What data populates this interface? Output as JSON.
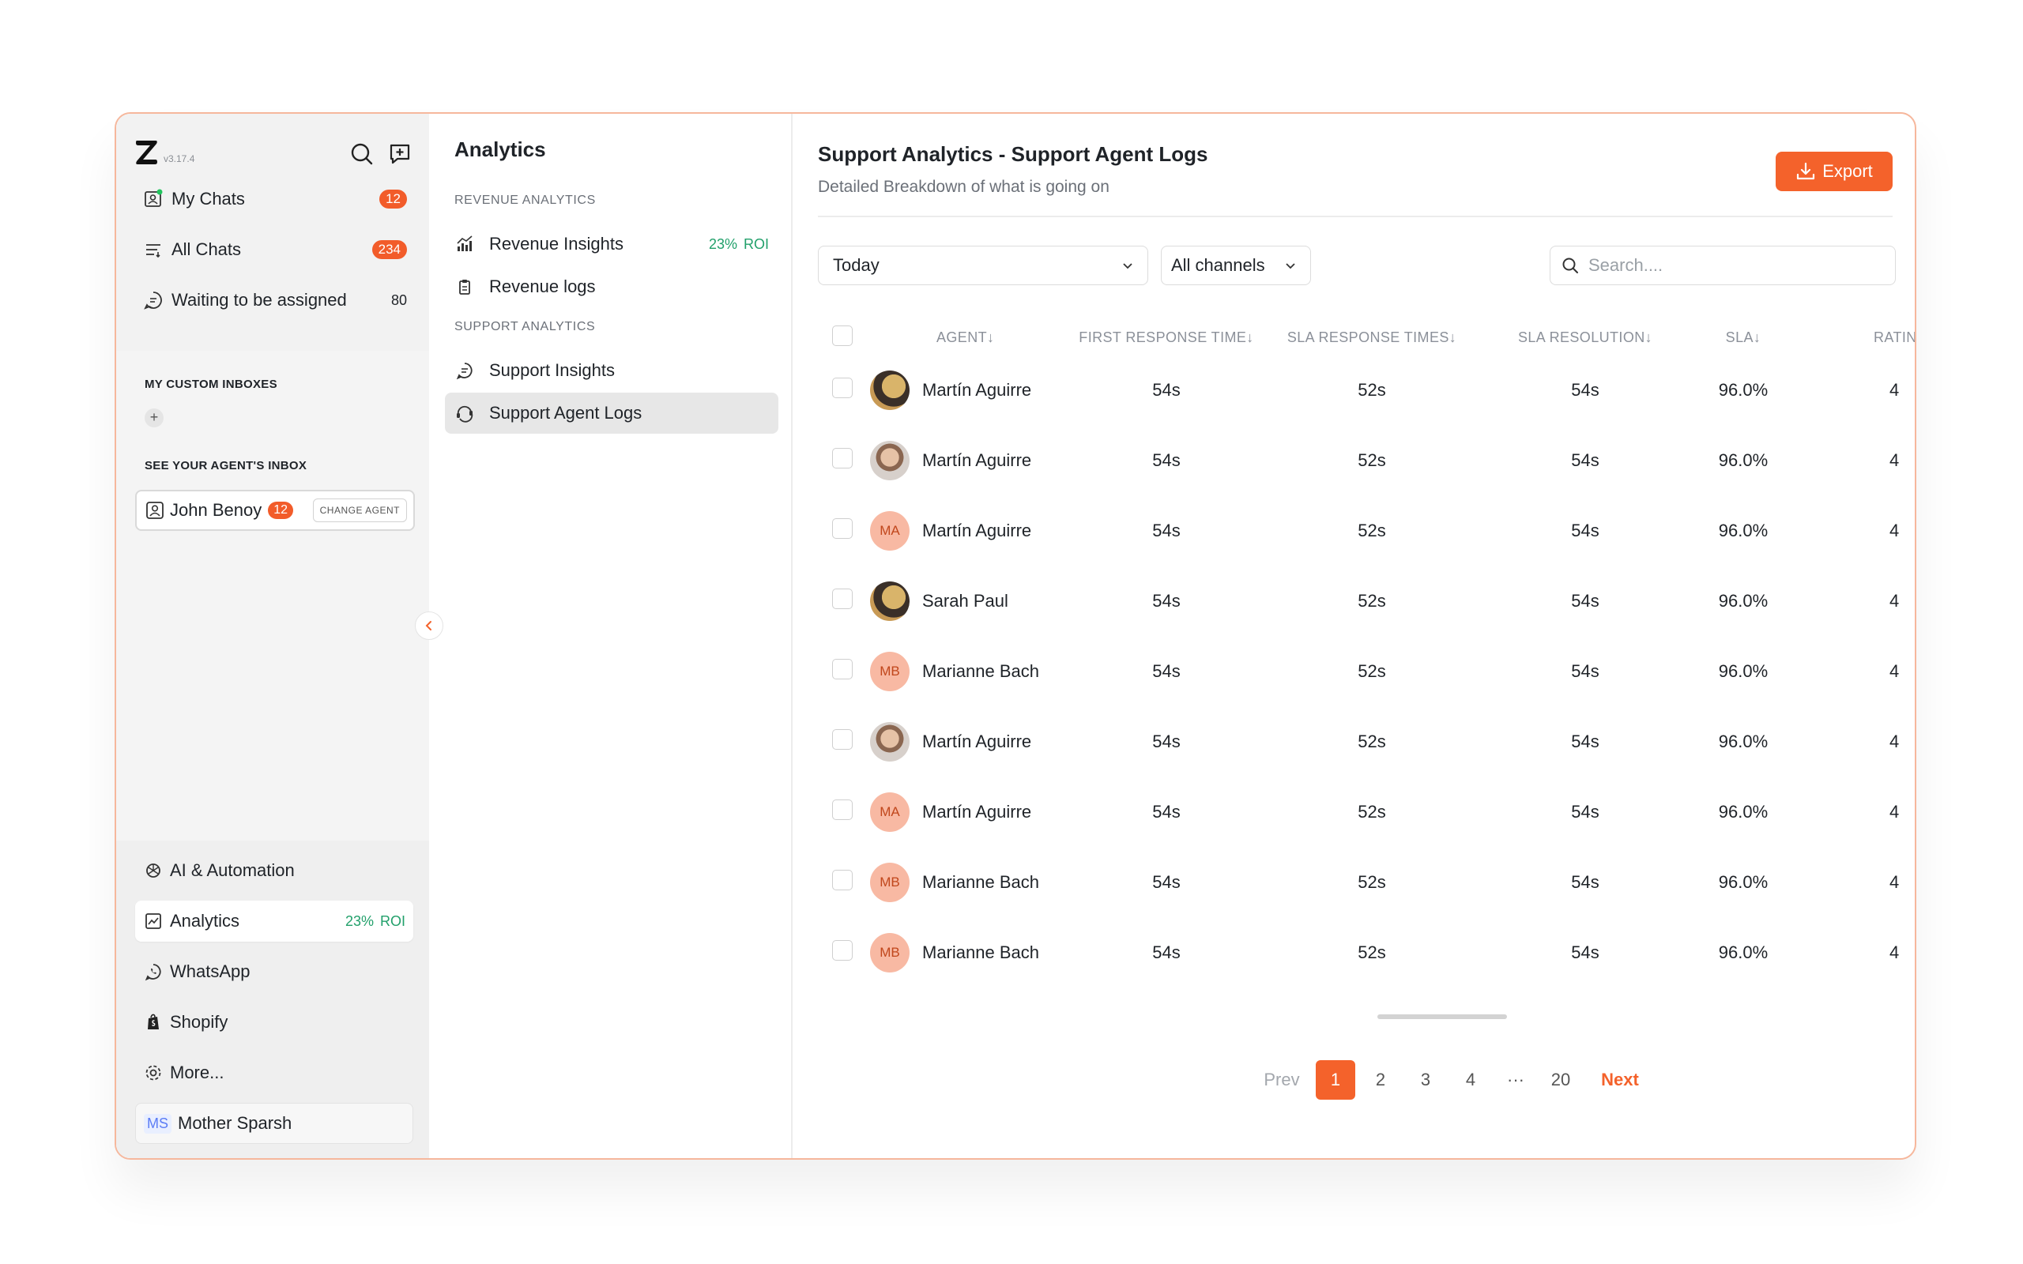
{
  "app": {
    "version": "v3.17.4",
    "accent": "#f4622b"
  },
  "sidebar": {
    "nav": [
      {
        "label": "My Chats",
        "count": "12",
        "icon": "chat-user-icon"
      },
      {
        "label": "All Chats",
        "count": "234",
        "icon": "list-filter-icon"
      },
      {
        "label": "Waiting to be assigned",
        "count": "80",
        "icon": "chat-wait-icon"
      }
    ],
    "custom_inboxes_label": "MY CUSTOM INBOXES",
    "add_label": "+",
    "agent_inbox_label": "SEE YOUR AGENT'S INBOX",
    "agent": {
      "name": "John Benoy",
      "count": "12",
      "change_label": "CHANGE AGENT"
    },
    "bottom": [
      {
        "label": "AI & Automation",
        "icon": "ai-icon"
      },
      {
        "label": "Analytics",
        "icon": "chart-icon",
        "roi_value": "23%",
        "roi_label": "ROI"
      },
      {
        "label": "WhatsApp",
        "icon": "whatsapp-icon"
      },
      {
        "label": "Shopify",
        "icon": "shopify-icon"
      },
      {
        "label": "More...",
        "icon": "settings-icon"
      }
    ],
    "user": {
      "initials": "MS",
      "name": "Mother Sparsh"
    }
  },
  "mid": {
    "title": "Analytics",
    "revenue_label": "REVENUE ANALYTICS",
    "revenue_insights": "Revenue Insights",
    "revenue_roi_value": "23%",
    "revenue_roi_label": "ROI",
    "revenue_logs": "Revenue logs",
    "support_label": "SUPPORT ANALYTICS",
    "support_insights": "Support Insights",
    "support_agent_logs": "Support Agent Logs"
  },
  "main": {
    "title": "Support Analytics - Support Agent Logs",
    "subtitle": "Detailed Breakdown of what is going on",
    "export_label": "Export",
    "date_filter": "Today",
    "channel_filter": "All channels",
    "search_placeholder": "Search....",
    "columns": {
      "agent": "AGENT",
      "first_response": "FIRST RESPONSE TIME",
      "sla_response": "SLA RESPONSE TIMES",
      "sla_resolution": "SLA RESOLUTION",
      "sla": "SLA",
      "rating": "RATIN"
    },
    "rows": [
      {
        "name": "Martín Aguirre",
        "avatar": "photo-dark",
        "initials": "",
        "first": "54s",
        "sla_resp": "52s",
        "sla_res": "54s",
        "sla": "96.0%",
        "rating": "4"
      },
      {
        "name": "Martín Aguirre",
        "avatar": "photo-light",
        "initials": "",
        "first": "54s",
        "sla_resp": "52s",
        "sla_res": "54s",
        "sla": "96.0%",
        "rating": "4"
      },
      {
        "name": "Martín Aguirre",
        "avatar": "initials",
        "initials": "MA",
        "first": "54s",
        "sla_resp": "52s",
        "sla_res": "54s",
        "sla": "96.0%",
        "rating": "4"
      },
      {
        "name": "Sarah Paul",
        "avatar": "photo-dark",
        "initials": "",
        "first": "54s",
        "sla_resp": "52s",
        "sla_res": "54s",
        "sla": "96.0%",
        "rating": "4"
      },
      {
        "name": "Marianne Bach",
        "avatar": "initials",
        "initials": "MB",
        "first": "54s",
        "sla_resp": "52s",
        "sla_res": "54s",
        "sla": "96.0%",
        "rating": "4"
      },
      {
        "name": "Martín Aguirre",
        "avatar": "photo-light",
        "initials": "",
        "first": "54s",
        "sla_resp": "52s",
        "sla_res": "54s",
        "sla": "96.0%",
        "rating": "4"
      },
      {
        "name": "Martín Aguirre",
        "avatar": "initials",
        "initials": "MA",
        "first": "54s",
        "sla_resp": "52s",
        "sla_res": "54s",
        "sla": "96.0%",
        "rating": "4"
      },
      {
        "name": "Marianne Bach",
        "avatar": "initials",
        "initials": "MB",
        "first": "54s",
        "sla_resp": "52s",
        "sla_res": "54s",
        "sla": "96.0%",
        "rating": "4"
      },
      {
        "name": "Marianne Bach",
        "avatar": "initials",
        "initials": "MB",
        "first": "54s",
        "sla_resp": "52s",
        "sla_res": "54s",
        "sla": "96.0%",
        "rating": "4"
      }
    ],
    "pagination": {
      "prev": "Prev",
      "pages": [
        "1",
        "2",
        "3",
        "4",
        "···",
        "20"
      ],
      "current": "1",
      "next": "Next"
    }
  }
}
